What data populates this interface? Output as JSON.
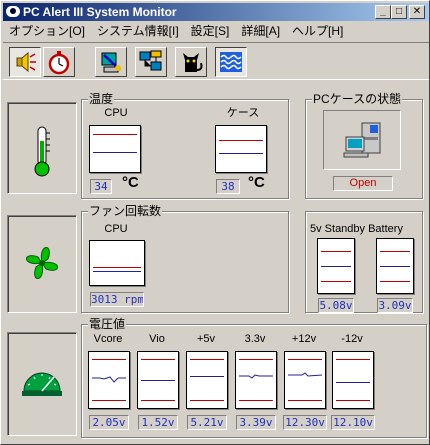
{
  "window": {
    "title": "PC Alert III System Monitor"
  },
  "title_buttons": {
    "minimize": "_",
    "maximize": "□",
    "close": "✕"
  },
  "menu": [
    "オプション[O]",
    "システム情報[I]",
    "設定[S]",
    "詳細[A]",
    "ヘルプ[H]"
  ],
  "toolbar": [
    "speaker-icon",
    "stopwatch-icon",
    "pc-signal-icon",
    "network-icon",
    "black-cat-icon",
    "waves-icon"
  ],
  "temperature": {
    "label": "温度",
    "cpu": {
      "caption": "CPU",
      "value": "34"
    },
    "case": {
      "caption": "ケース",
      "value": "38"
    },
    "unit": "°C"
  },
  "pc_case": {
    "label": "PCケースの状態",
    "status": "Open"
  },
  "fan": {
    "label": "ファン回転数",
    "cpu": {
      "caption": "CPU",
      "value": "3013 rpm"
    }
  },
  "battery": {
    "captions": "5v Standby Battery",
    "standby": "5.08v",
    "battery": "3.09v"
  },
  "voltage": {
    "label": "電圧値",
    "items": [
      {
        "caption": "Vcore",
        "value": "2.05v"
      },
      {
        "caption": "Vio",
        "value": "1.52v"
      },
      {
        "caption": "+5v",
        "value": "5.21v"
      },
      {
        "caption": "3.3v",
        "value": "3.39v"
      },
      {
        "caption": "+12v",
        "value": "12.30v"
      },
      {
        "caption": "-12v",
        "value": "12.10v"
      }
    ]
  },
  "colors": {
    "title_start": "#0a246a",
    "title_end": "#a6caf0",
    "value_text": "#2030c0",
    "alert": "#c00000",
    "gauge_upper": "#c00000",
    "gauge_lower": "#2020a0"
  }
}
